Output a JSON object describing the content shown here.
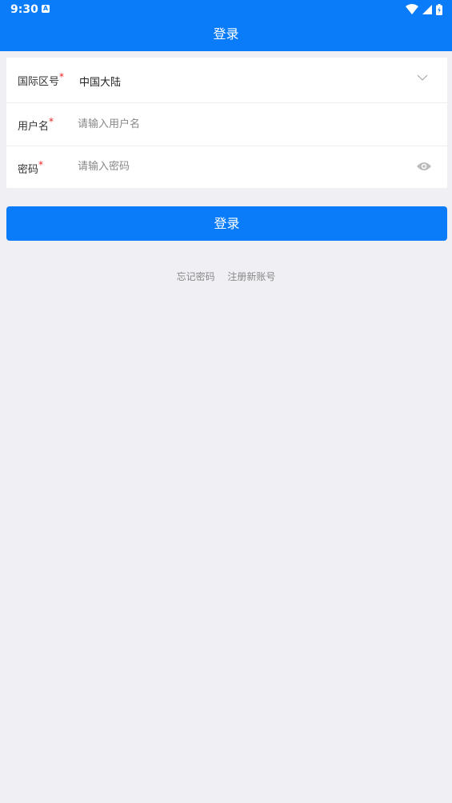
{
  "status_bar": {
    "time": "9:30",
    "notification_icon": "a-icon",
    "icons": [
      "wifi-icon",
      "signal-icon",
      "battery-icon"
    ]
  },
  "header": {
    "title": "登录"
  },
  "form": {
    "region": {
      "label": "国际区号",
      "required_mark": "*",
      "value": "中国大陆"
    },
    "username": {
      "label": "用户名",
      "required_mark": "*",
      "value": "",
      "placeholder": "请输入用户名"
    },
    "password": {
      "label": "密码",
      "required_mark": "*",
      "value": "",
      "placeholder": "请输入密码"
    }
  },
  "login_button": {
    "label": "登录"
  },
  "links": {
    "forgot_password": "忘记密码",
    "register": "注册新账号"
  },
  "colors": {
    "primary": "#0a7cf9",
    "background": "#efeff4",
    "required": "#ee2222",
    "muted_text": "#888888"
  }
}
